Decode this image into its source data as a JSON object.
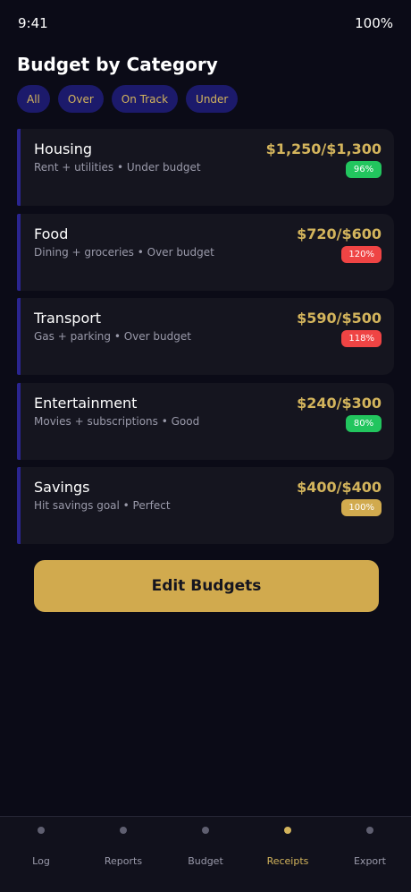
{
  "status_bar": {
    "time": "9:41",
    "battery": "100%"
  },
  "page": {
    "title": "Budget by Category"
  },
  "filters": [
    "All",
    "Over",
    "On Track",
    "Under"
  ],
  "categories": [
    {
      "name": "Housing",
      "description": "Rent + utilities • Under budget",
      "amount": "$1,250/$1,300",
      "percent": "96%",
      "status": "good"
    },
    {
      "name": "Food",
      "description": "Dining + groceries • Over budget",
      "amount": "$720/$600",
      "percent": "120%",
      "status": "over"
    },
    {
      "name": "Transport",
      "description": "Gas + parking • Over budget",
      "amount": "$590/$500",
      "percent": "118%",
      "status": "over"
    },
    {
      "name": "Entertainment",
      "description": "Movies + subscriptions • Good",
      "amount": "$240/$300",
      "percent": "80%",
      "status": "good"
    },
    {
      "name": "Savings",
      "description": "Hit savings goal • Perfect",
      "amount": "$400/$400",
      "percent": "100%",
      "status": "perfect"
    }
  ],
  "actions": {
    "edit_label": "Edit Budgets"
  },
  "tab_bar": {
    "tabs": [
      "Log",
      "Reports",
      "Budget",
      "Receipts",
      "Export"
    ],
    "active": "Receipts"
  },
  "colors": {
    "background": "#0b0b17",
    "accent_gold": "#d3b45c",
    "chip_background": "#1c1a6b",
    "status_good": "#22c55e",
    "status_over": "#ef4444",
    "status_perfect": "#d1aa4e"
  }
}
